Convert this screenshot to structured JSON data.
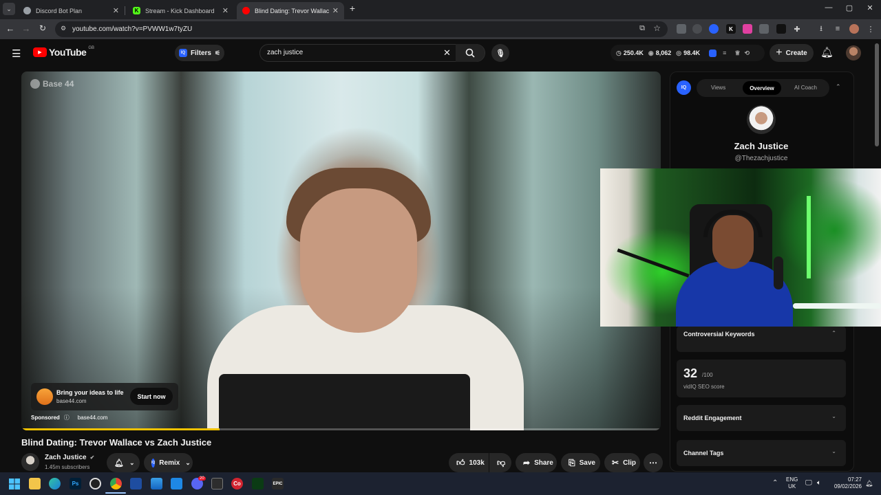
{
  "browser": {
    "tabs": [
      {
        "label": "Discord Bot Plan",
        "favicon_color": "#9aa0a6"
      },
      {
        "label": "Stream - Kick Dashboard",
        "favicon_color": "#53fc18"
      },
      {
        "label": "Blind Dating: Trevor Wallace vs",
        "favicon_color": "#ff0000"
      }
    ],
    "new_tab_symbol": "+",
    "url": "youtube.com/watch?v=PVWW1w7tyZU",
    "window_controls": {
      "minimize": "—",
      "maximize": "▢",
      "close": "✕"
    }
  },
  "youtube": {
    "logo_text": "YouTube",
    "region": "GB",
    "filters_label": "Filters",
    "search_value": "zach justice",
    "stats": {
      "views": "250.4K",
      "videos": "8,062",
      "watching": "98.4K"
    },
    "create_label": "Create"
  },
  "video": {
    "watermark": "Base 44",
    "progress_fraction": 0.31,
    "ad": {
      "headline": "Bring your ideas to life",
      "domain": "base44.com",
      "cta": "Start now",
      "sponsored_label": "Sponsored",
      "sponsored_domain": "base44.com"
    },
    "title": "Blind Dating: Trevor Wallace vs Zach Justice",
    "channel": {
      "name": "Zach Justice",
      "subscribers": "1.45m subscribers"
    },
    "actions": {
      "remix": "Remix",
      "likes": "103k",
      "share": "Share",
      "save": "Save",
      "clip": "Clip"
    }
  },
  "vidiq": {
    "logo": "IQ",
    "tabs": [
      "Views",
      "Overview",
      "AI Coach"
    ],
    "active_tab": "Overview",
    "channel_name": "Zach Justice",
    "handle": "@Thezachjustice",
    "cards": {
      "controversial": "Controversial Keywords",
      "seo_score": "32",
      "seo_max": "/100",
      "seo_label": "vidIQ SEO score",
      "reddit": "Reddit Engagement",
      "channel_tags": "Channel Tags"
    }
  },
  "taskbar": {
    "apps": [
      "Ps",
      "Co",
      "EPIC"
    ],
    "discord_badge": "20",
    "language": "ENG",
    "region": "UK",
    "time": "07:27",
    "date": "09/02/2026"
  },
  "colors": {
    "youtube_red": "#ff0000",
    "vidiq_blue": "#2962ff",
    "ad_orange": "#f28c1b",
    "progress_yellow": "#f2c200"
  }
}
